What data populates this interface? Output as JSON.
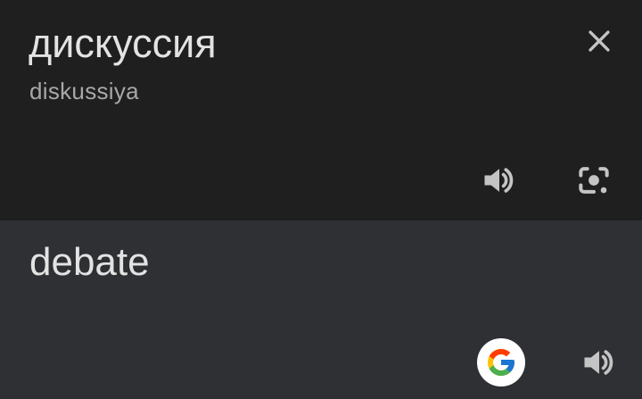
{
  "source": {
    "text": "дискуссия",
    "transliteration": "diskussiya"
  },
  "target": {
    "text": "debate"
  },
  "icons": {
    "close": "close-icon",
    "source_speaker": "speaker-icon",
    "lens": "camera-lens-icon",
    "google": "google-logo-icon",
    "target_speaker": "speaker-icon"
  },
  "colors": {
    "source_background": "#1f1f1f",
    "target_background": "#2f3034",
    "text_primary": "#e3e3e3",
    "text_secondary": "#a8a8a8",
    "icon": "#c4c4c4"
  }
}
